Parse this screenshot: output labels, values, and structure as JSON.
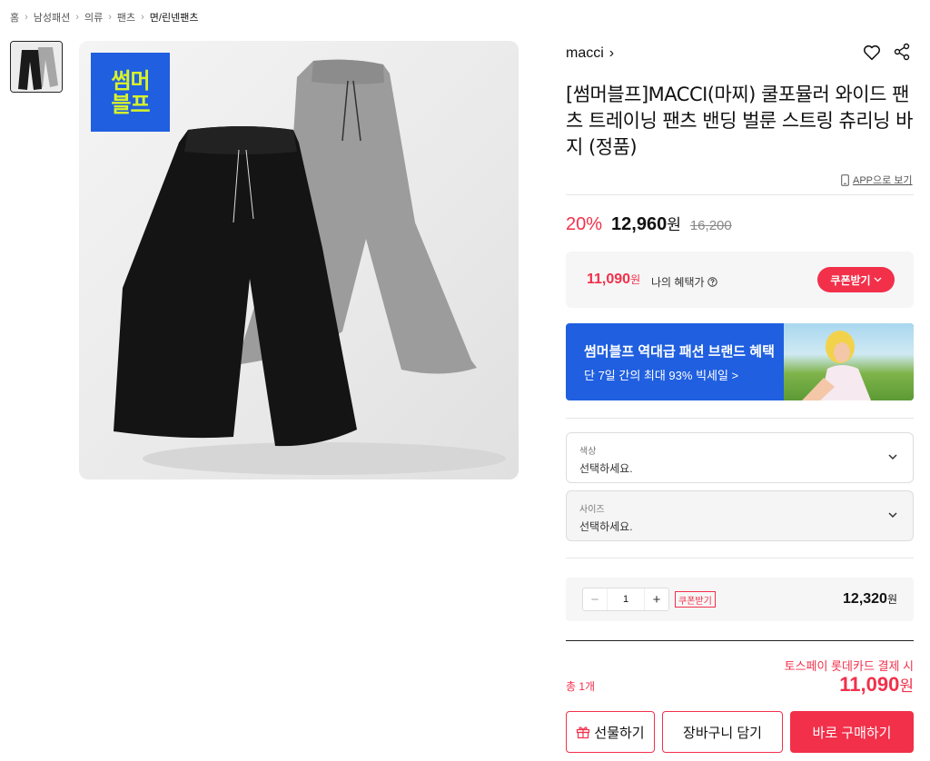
{
  "breadcrumb": {
    "items": [
      "홈",
      "남성패션",
      "의류",
      "팬츠",
      "면/린넨팬츠"
    ]
  },
  "gallery": {
    "badge_line1": "썸머",
    "badge_line2": "블프"
  },
  "product": {
    "brand": "macci",
    "title": "[썸머블프]MACCI(마찌) 쿨포뮬러 와이드 팬츠 트레이닝 팬츠 밴딩 벌룬 스트링 츄리닝 바지 (정품)",
    "app_view": "APP으로 보기",
    "discount": "20%",
    "price": "12,960",
    "won": "원",
    "original_price": "16,200"
  },
  "benefit": {
    "price": "11,090",
    "won": "원",
    "label": "나의 혜택가",
    "coupon_label": "쿠폰받기"
  },
  "banner": {
    "title": "썸머블프 역대급 패션 브랜드 혜택",
    "subtitle": "단 7일 간의 최대 93% 빅세일 >"
  },
  "options": [
    {
      "label": "색상",
      "value": "선택하세요."
    },
    {
      "label": "사이즈",
      "value": "선택하세요."
    }
  ],
  "quantity": {
    "minus": "−",
    "value": "1",
    "plus": "+",
    "coupon_label": "쿠폰받기",
    "price": "12,320",
    "won": "원"
  },
  "total": {
    "toss_label": "토스페이 롯데카드 결제 시",
    "count": "총 1개",
    "price": "11,090",
    "won": "원"
  },
  "buttons": {
    "gift": "선물하기",
    "cart": "장바구니 담기",
    "buy": "바로 구매하기"
  },
  "colors": {
    "accent": "#f2304a",
    "banner_blue": "#1f5fe0",
    "badge_green": "#d8f22a"
  }
}
